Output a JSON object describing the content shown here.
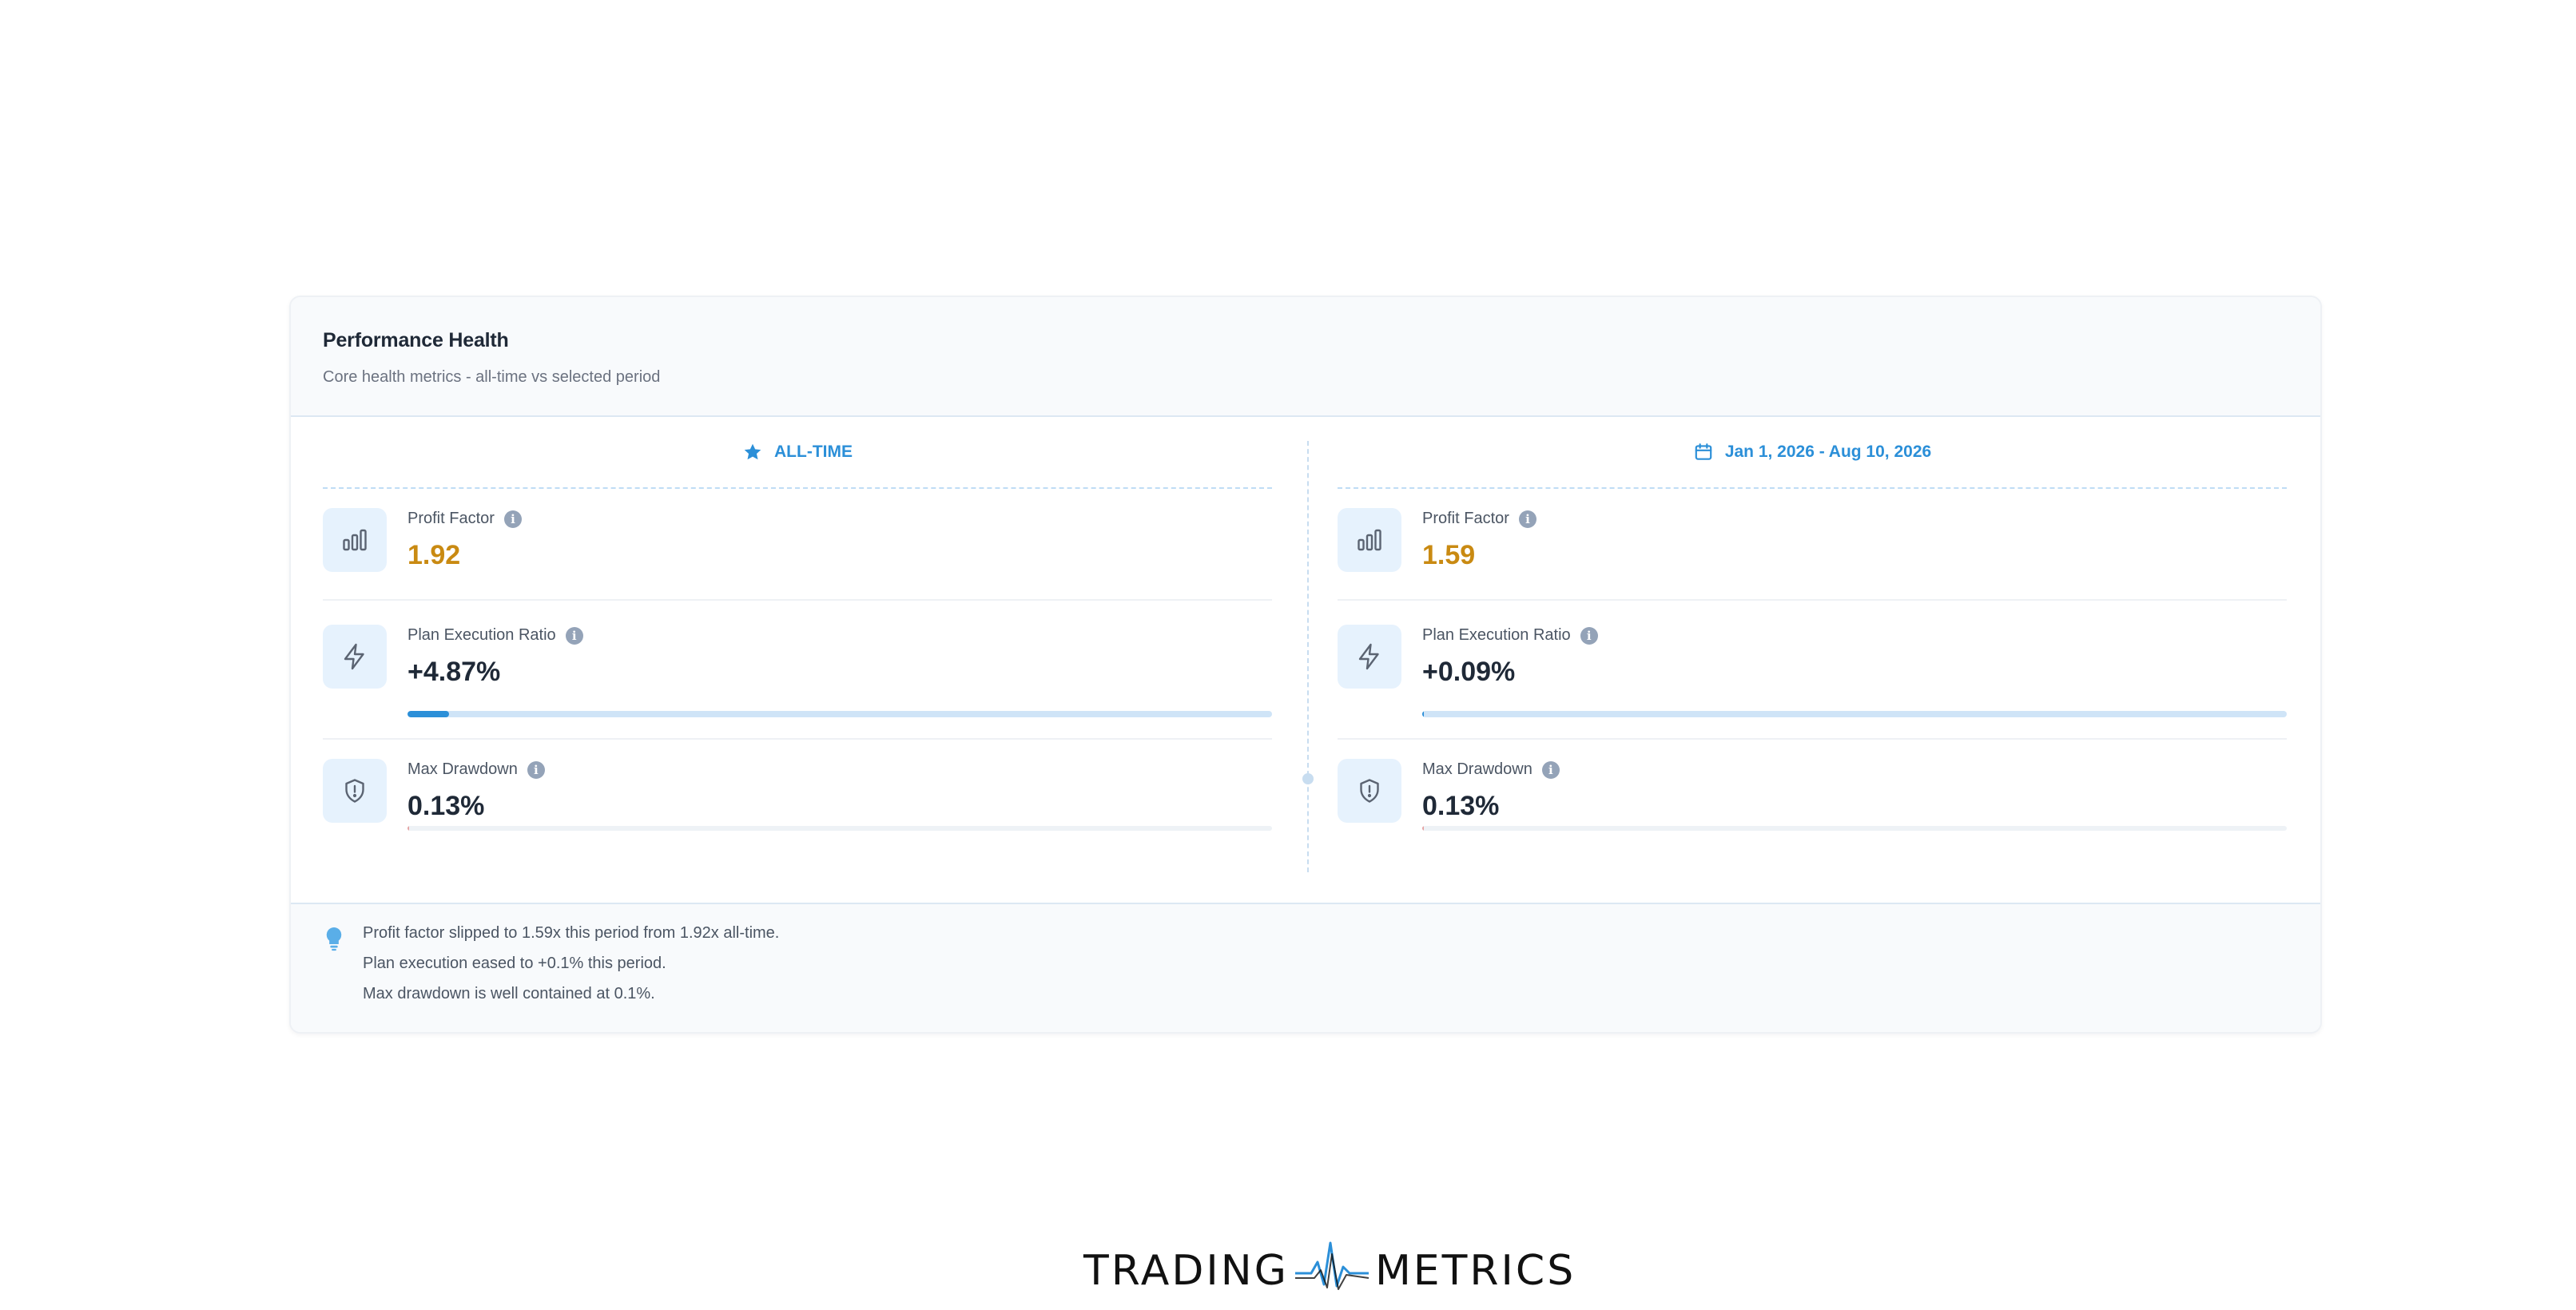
{
  "card": {
    "title": "Performance Health",
    "subtitle": "Core health metrics - all-time vs selected period"
  },
  "columns": [
    {
      "header": "ALL-TIME",
      "header_icon": "star-icon",
      "profit_factor": {
        "label": "Profit Factor",
        "value": "1.92"
      },
      "plan_execution": {
        "label": "Plan Execution Ratio",
        "value": "+4.87%",
        "bar_fraction": 0.048
      },
      "max_drawdown": {
        "label": "Max Drawdown",
        "value": "0.13%",
        "bar_fraction": 0.0013
      }
    },
    {
      "header": "Jan 1, 2026 - Aug 10, 2026",
      "header_icon": "calendar-icon",
      "profit_factor": {
        "label": "Profit Factor",
        "value": "1.59"
      },
      "plan_execution": {
        "label": "Plan Execution Ratio",
        "value": "+0.09%",
        "bar_fraction": 0.0009
      },
      "max_drawdown": {
        "label": "Max Drawdown",
        "value": "0.13%",
        "bar_fraction": 0.0013
      }
    }
  ],
  "insights": {
    "icon": "lightbulb-icon",
    "lines": [
      "Profit factor slipped to 1.59x this period from 1.92x all-time.",
      "Plan execution eased to +0.1% this period.",
      "Max drawdown is well contained at 0.1%."
    ]
  },
  "logo": {
    "left": "TRADING",
    "right": "METRICS"
  },
  "colors": {
    "accent": "#2b8fd8",
    "profit_factor_value": "#c98a12",
    "icon_bg": "#e6f2fd"
  }
}
